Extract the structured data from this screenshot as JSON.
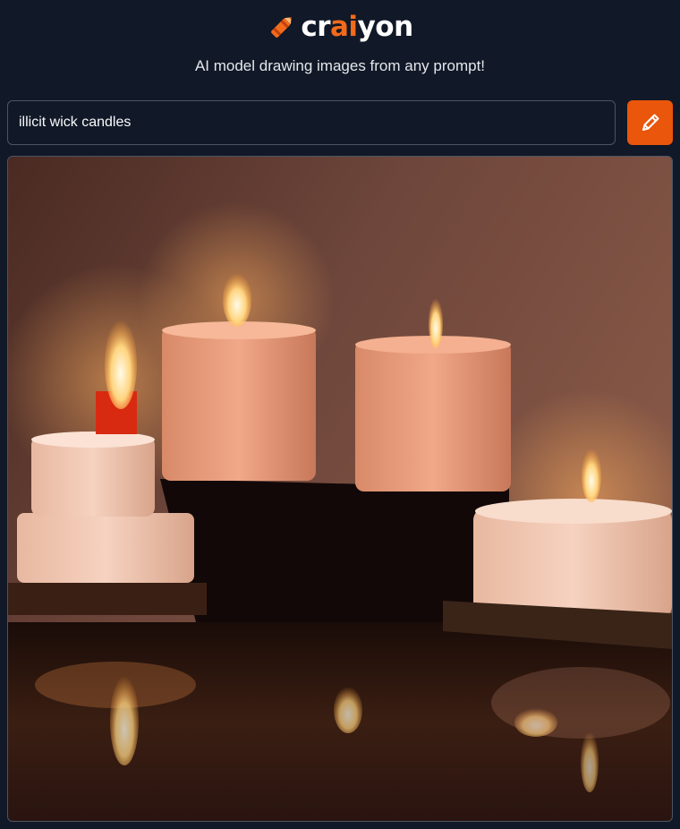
{
  "app": {
    "logo_prefix": "cr",
    "logo_accent": "ai",
    "logo_suffix": "yon",
    "logo_icon": "crayon-icon",
    "tagline": "AI model drawing images from any prompt!"
  },
  "prompt": {
    "value": "illicit wick candles",
    "draw_button_icon": "pencil-icon"
  },
  "result": {
    "image_description_icon": "generated-image"
  },
  "colors": {
    "background": "#111827",
    "accent": "#e9560c",
    "border": "#4b5563",
    "text": "#ffffff"
  }
}
